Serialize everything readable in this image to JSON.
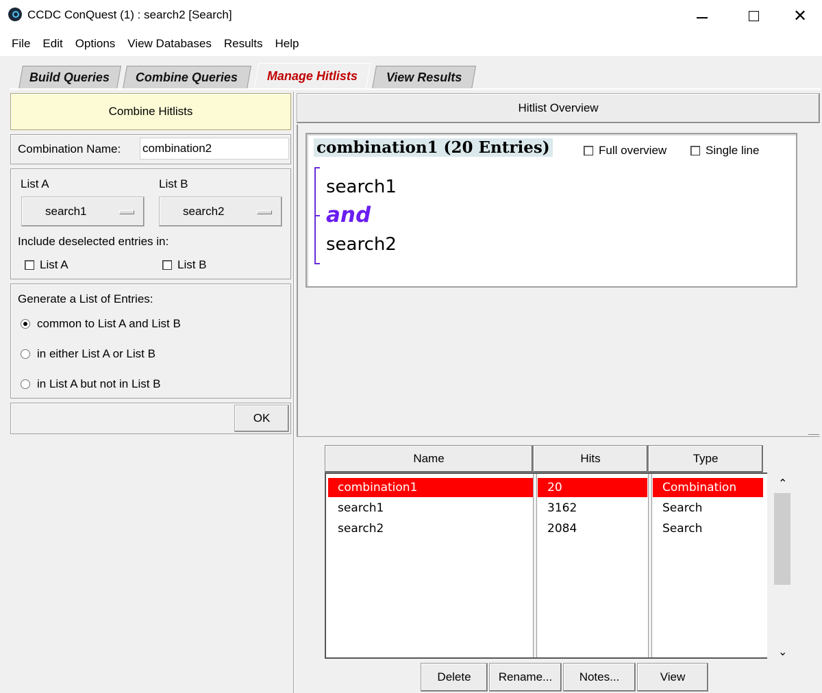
{
  "window": {
    "title": "CCDC ConQuest (1) : search2 [Search]",
    "icon": "conquest-logo-icon"
  },
  "menu": [
    "File",
    "Edit",
    "Options",
    "View Databases",
    "Results",
    "Help"
  ],
  "tabs": [
    {
      "label": "Build Queries",
      "active": false
    },
    {
      "label": "Combine Queries",
      "active": false
    },
    {
      "label": "Manage Hitlists",
      "active": true
    },
    {
      "label": "View Results",
      "active": false
    }
  ],
  "combine": {
    "header": "Combine Hitlists",
    "name_label": "Combination Name:",
    "name_value": "combination2",
    "list_a_label": "List A",
    "list_b_label": "List B",
    "list_a_value": "search1",
    "list_b_value": "search2",
    "include_label": "Include deselected entries in:",
    "include_a": "List A",
    "include_b": "List B",
    "generate_label": "Generate a List of Entries:",
    "options": [
      {
        "label": "common to List A and List B",
        "selected": true
      },
      {
        "label": "in either List A or List B",
        "selected": false
      },
      {
        "label": "in List A but not in List B",
        "selected": false
      }
    ],
    "ok_label": "OK"
  },
  "overview": {
    "header": "Hitlist Overview",
    "title": "combination1 (20 Entries)",
    "full_overview": "Full overview",
    "single_line": "Single line",
    "query1": "search1",
    "operator": "and",
    "query2": "search2",
    "operator_color": "#6a1ef0"
  },
  "hitlists": {
    "columns": [
      "Name",
      "Hits",
      "Type"
    ],
    "rows": [
      {
        "name": "combination1",
        "hits": "20",
        "type": "Combination",
        "selected": true
      },
      {
        "name": "search1",
        "hits": "3162",
        "type": "Search",
        "selected": false
      },
      {
        "name": "search2",
        "hits": "2084",
        "type": "Search",
        "selected": false
      }
    ],
    "selection_color": "#ff0000"
  },
  "buttons": {
    "delete": "Delete",
    "rename": "Rename...",
    "notes": "Notes...",
    "view": "View"
  }
}
